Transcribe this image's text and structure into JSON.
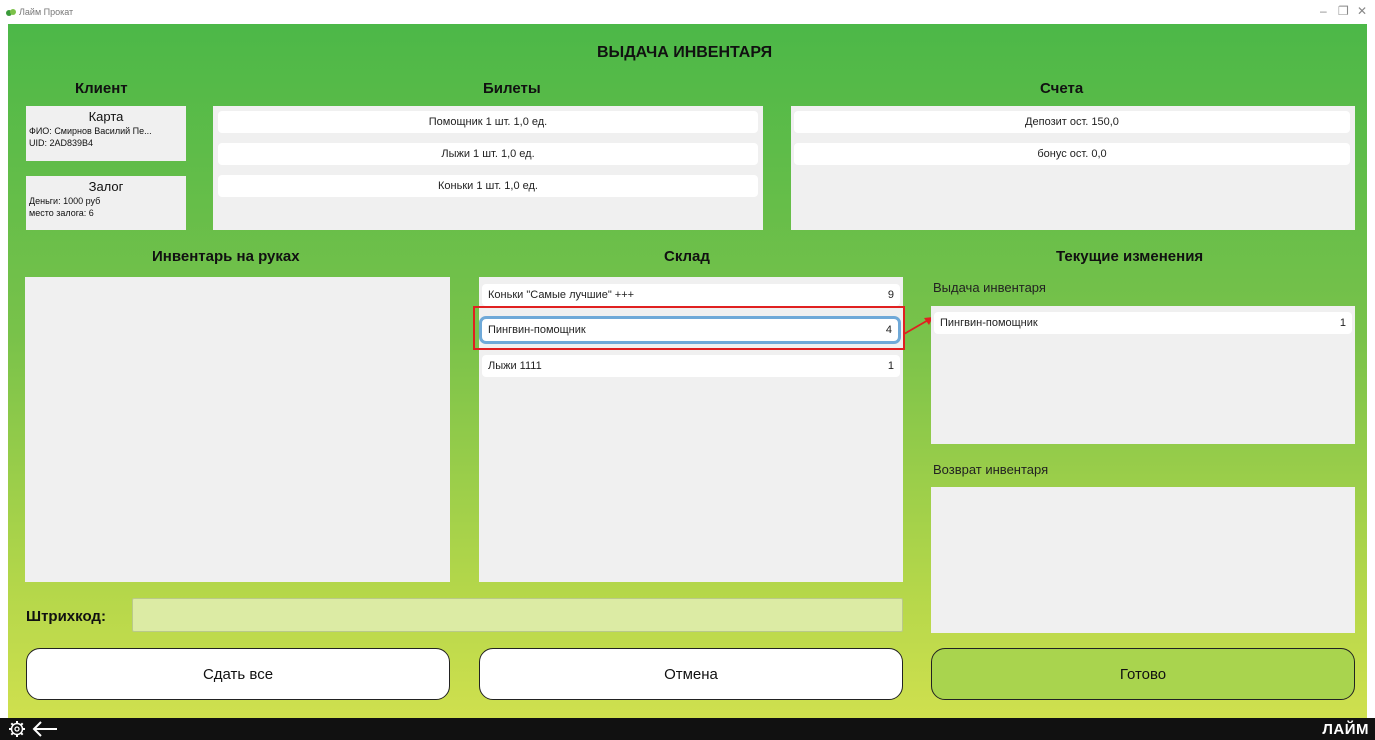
{
  "window": {
    "title": "Лайм Прокат"
  },
  "page": {
    "title": "ВЫДАЧА ИНВЕНТАРЯ"
  },
  "client": {
    "heading": "Клиент",
    "card": {
      "title": "Карта",
      "fio": "ФИО: Смирнов Василий Пе...",
      "uid": "UID: 2AD839B4"
    },
    "deposit": {
      "title": "Залог",
      "money": "Деньги: 1000 руб",
      "place": "место залога: 6"
    }
  },
  "tickets": {
    "heading": "Билеты",
    "items": [
      "Помощник 1 шт. 1,0 ед.",
      "Лыжи 1 шт. 1,0 ед.",
      "Коньки 1 шт. 1,0 ед."
    ]
  },
  "accounts": {
    "heading": "Счета",
    "items": [
      "Депозит ост. 150,0",
      "бонус ост. 0,0"
    ]
  },
  "inventory_hands": {
    "heading": "Инвентарь на руках"
  },
  "warehouse": {
    "heading": "Склад",
    "items": [
      {
        "name": "Коньки \"Самые лучшие\" +++",
        "count": "9"
      },
      {
        "name": "Пингвин-помощник",
        "count": "4"
      },
      {
        "name": "Лыжи 1111",
        "count": "1"
      }
    ]
  },
  "changes": {
    "heading": "Текущие изменения",
    "issue_label": "Выдача инвентаря",
    "issue_items": [
      {
        "name": "Пингвин-помощник",
        "count": "1"
      }
    ],
    "return_label": "Возврат инвентаря"
  },
  "barcode": {
    "label": "Штрихкод:",
    "value": ""
  },
  "buttons": {
    "return_all": "Сдать все",
    "cancel": "Отмена",
    "done": "Готово"
  },
  "brand": {
    "logo": "ЛАЙМ"
  },
  "colors": {
    "accent_green": "#4cb848",
    "highlight_red": "#e02020",
    "selection_blue": "#6fa9d8"
  }
}
